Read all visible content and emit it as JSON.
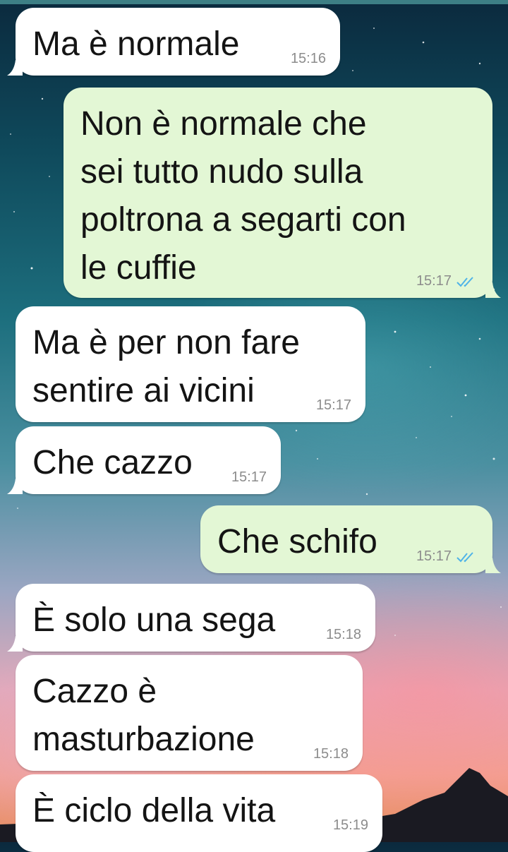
{
  "messages": [
    {
      "dir": "in",
      "text": "Ma è normale",
      "time": "15:16",
      "read": false
    },
    {
      "dir": "out",
      "text": "Non è normale che\nsei tutto nudo sulla\npoltrona a segarti con\nle cuffie",
      "time": "15:17",
      "read": true
    },
    {
      "dir": "in",
      "text": "Ma è per non fare\nsentire ai vicini",
      "time": "15:17",
      "read": false
    },
    {
      "dir": "in",
      "text": "Che cazzo",
      "time": "15:17",
      "read": false
    },
    {
      "dir": "out",
      "text": "Che schifo",
      "time": "15:17",
      "read": true
    },
    {
      "dir": "in",
      "text": "È solo una sega",
      "time": "15:18",
      "read": false
    },
    {
      "dir": "in",
      "text": "Cazzo è\nmasturbazione",
      "time": "15:18",
      "read": false
    },
    {
      "dir": "in",
      "text": "È ciclo della vita",
      "time": "15:19",
      "read": false
    }
  ],
  "colors": {
    "incoming_bubble": "#ffffff",
    "outgoing_bubble": "#e3f7d5",
    "read_ticks": "#4fb3e8",
    "timestamp": "#8c8c8c"
  },
  "icons": {
    "read_receipt": "double-check-icon"
  }
}
